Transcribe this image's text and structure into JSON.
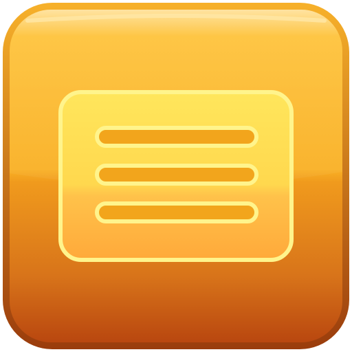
{
  "icon": {
    "name": "menu-list-icon",
    "colors": {
      "tile_top": "#FFC12E",
      "tile_mid": "#F7A51F",
      "tile_bottom": "#B9470F",
      "tile_border": "#F2A51C",
      "glyph_fill_top": "#FFE35A",
      "glyph_fill_bottom": "#FFAE3C",
      "glyph_outline": "#FFF48C"
    },
    "line_count": 3
  }
}
